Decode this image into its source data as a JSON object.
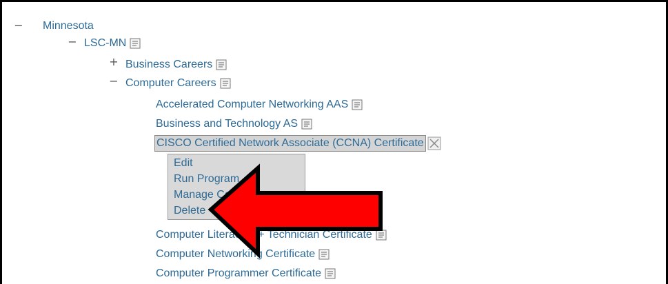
{
  "tree": {
    "root": {
      "label": "Minnesota",
      "toggle": "−"
    },
    "org": {
      "label": "LSC-MN",
      "toggle": "−"
    },
    "categories": [
      {
        "label": "Business Careers",
        "toggle": "+"
      },
      {
        "label": "Computer Careers",
        "toggle": "−"
      }
    ],
    "programs": [
      {
        "label": "Accelerated Computer Networking AAS"
      },
      {
        "label": "Business and Technology AS"
      },
      {
        "label": "CISCO Certified Network Associate (CCNA) Certificate",
        "selected": true
      },
      {
        "label": "Computer Literacy, A+ Technician Certificate"
      },
      {
        "label": "Computer Networking Certificate"
      },
      {
        "label": "Computer Programmer Certificate"
      }
    ]
  },
  "context_menu": {
    "items": [
      "Edit",
      "Run Program",
      "Manage Courses",
      "Delete"
    ]
  },
  "icons": {
    "document": "document-icon",
    "close": "close-icon",
    "arrow": "red-arrow-pointer"
  },
  "colors": {
    "link": "#2d6a96",
    "selection_bg": "#d4d4d4",
    "menu_bg": "#d9d9d9",
    "arrow_fill": "#ff0000",
    "arrow_stroke": "#000000"
  }
}
